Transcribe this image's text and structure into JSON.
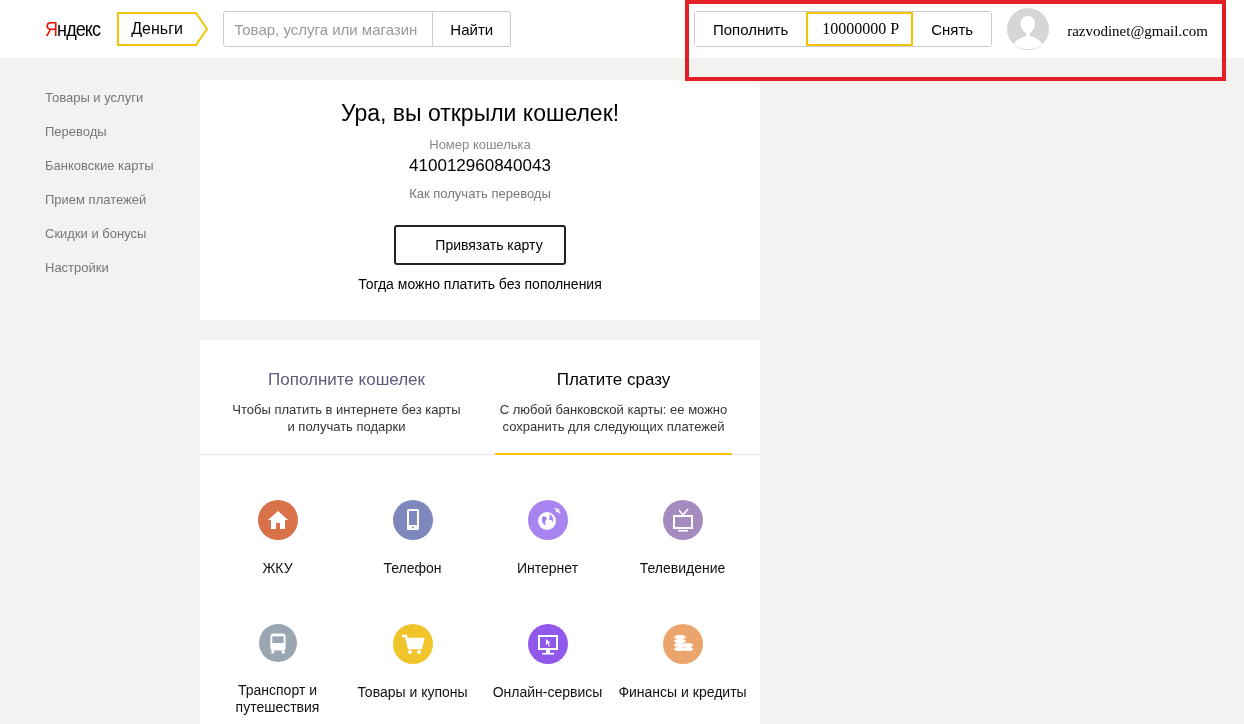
{
  "header": {
    "logo": "Яндекс",
    "service_tab": "Деньги",
    "search": {
      "placeholder": "Товар, услуга или магазин"
    },
    "search_button": "Найти",
    "wallet": {
      "top_up": "Пополнить",
      "balance": "10000000 Р",
      "withdraw": "Снять"
    },
    "email": "razvodinet@gmail.com",
    "highlighted": true
  },
  "sidebar": {
    "items": [
      "Товары и услуги",
      "Переводы",
      "Банковские карты",
      "Прием платежей",
      "Скидки и бонусы",
      "Настройки"
    ]
  },
  "wallet_card": {
    "title": "Ура, вы открыли кошелек!",
    "number_label": "Номер кошелька",
    "number": "410012960840043",
    "how_link": "Как получать переводы",
    "bind_button": "Привязать карту",
    "hint": "Тогда можно платить без пополнения"
  },
  "tabs": [
    {
      "title": "Пополните кошелек",
      "subtitle": "Чтобы платить в интернете без карты и получать подарки",
      "selected": false
    },
    {
      "title": "Платите сразу",
      "subtitle": "С любой банковской карты: ее можно сохранить для следующих платежей",
      "selected": true
    }
  ],
  "categories": [
    {
      "label": "ЖКУ",
      "kind": "house",
      "color": "#d9714a"
    },
    {
      "label": "Телефон",
      "kind": "phone",
      "color": "#7f88bd"
    },
    {
      "label": "Интернет",
      "kind": "globe",
      "color": "#a784f0"
    },
    {
      "label": "Телевидение",
      "kind": "tv",
      "color": "#a48cc0"
    },
    {
      "label": "Транспорт и путешествия",
      "kind": "bus",
      "color": "#9aa7b3"
    },
    {
      "label": "Товары и купоны",
      "kind": "cart",
      "color": "#f0c42a"
    },
    {
      "label": "Онлайн-сервисы",
      "kind": "monitor",
      "color": "#9158ec"
    },
    {
      "label": "Финансы и кредиты",
      "kind": "coins",
      "color": "#eba56c"
    }
  ]
}
